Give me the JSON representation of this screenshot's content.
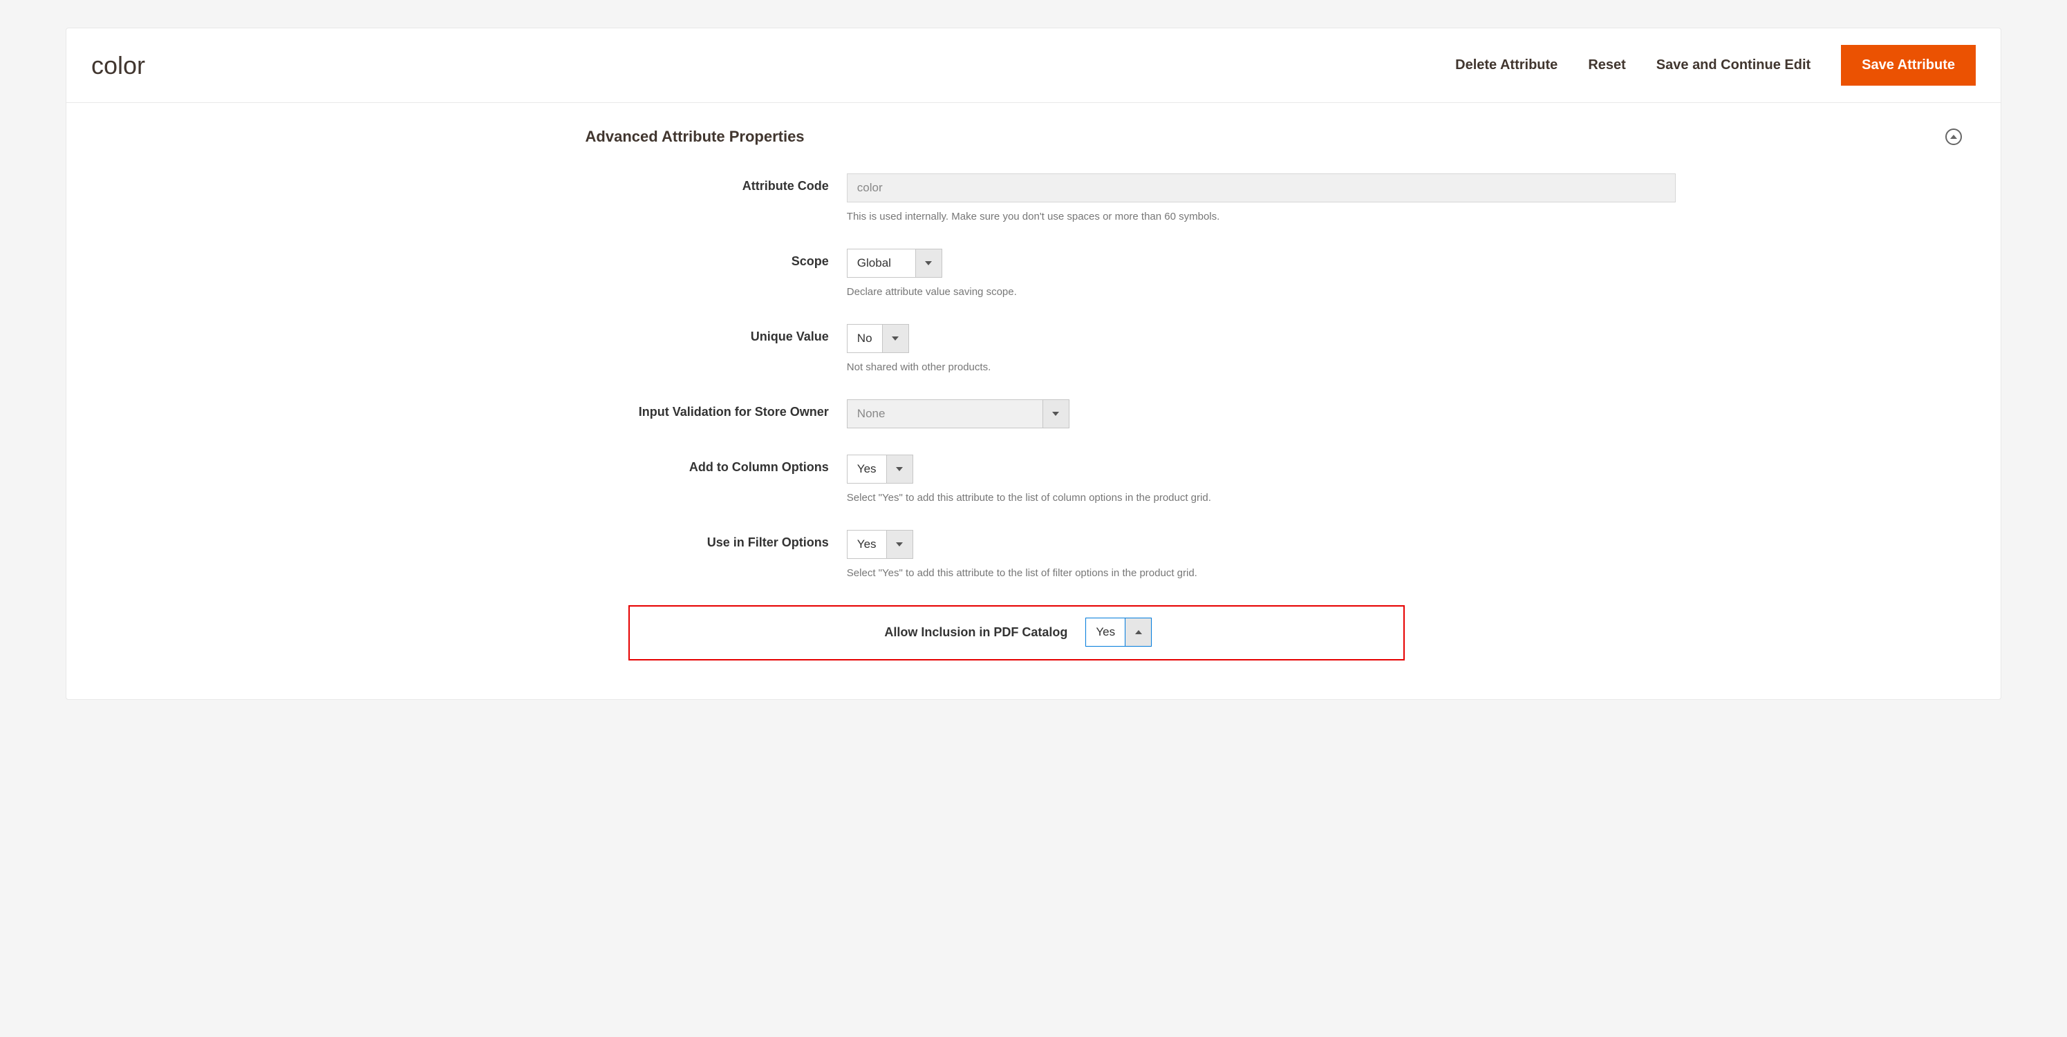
{
  "header": {
    "title": "color",
    "actions": {
      "delete": "Delete Attribute",
      "reset": "Reset",
      "save_continue": "Save and Continue Edit",
      "save": "Save Attribute"
    }
  },
  "section": {
    "title": "Advanced Attribute Properties"
  },
  "fields": {
    "attribute_code": {
      "label": "Attribute Code",
      "value": "color",
      "note": "This is used internally. Make sure you don't use spaces or more than 60 symbols."
    },
    "scope": {
      "label": "Scope",
      "value": "Global",
      "note": "Declare attribute value saving scope."
    },
    "unique_value": {
      "label": "Unique Value",
      "value": "No",
      "note": "Not shared with other products."
    },
    "input_validation": {
      "label": "Input Validation for Store Owner",
      "value": "None"
    },
    "add_to_column": {
      "label": "Add to Column Options",
      "value": "Yes",
      "note": "Select \"Yes\" to add this attribute to the list of column options in the product grid."
    },
    "use_in_filter": {
      "label": "Use in Filter Options",
      "value": "Yes",
      "note": "Select \"Yes\" to add this attribute to the list of filter options in the product grid."
    },
    "allow_pdf": {
      "label": "Allow Inclusion in PDF Catalog",
      "value": "Yes"
    }
  }
}
